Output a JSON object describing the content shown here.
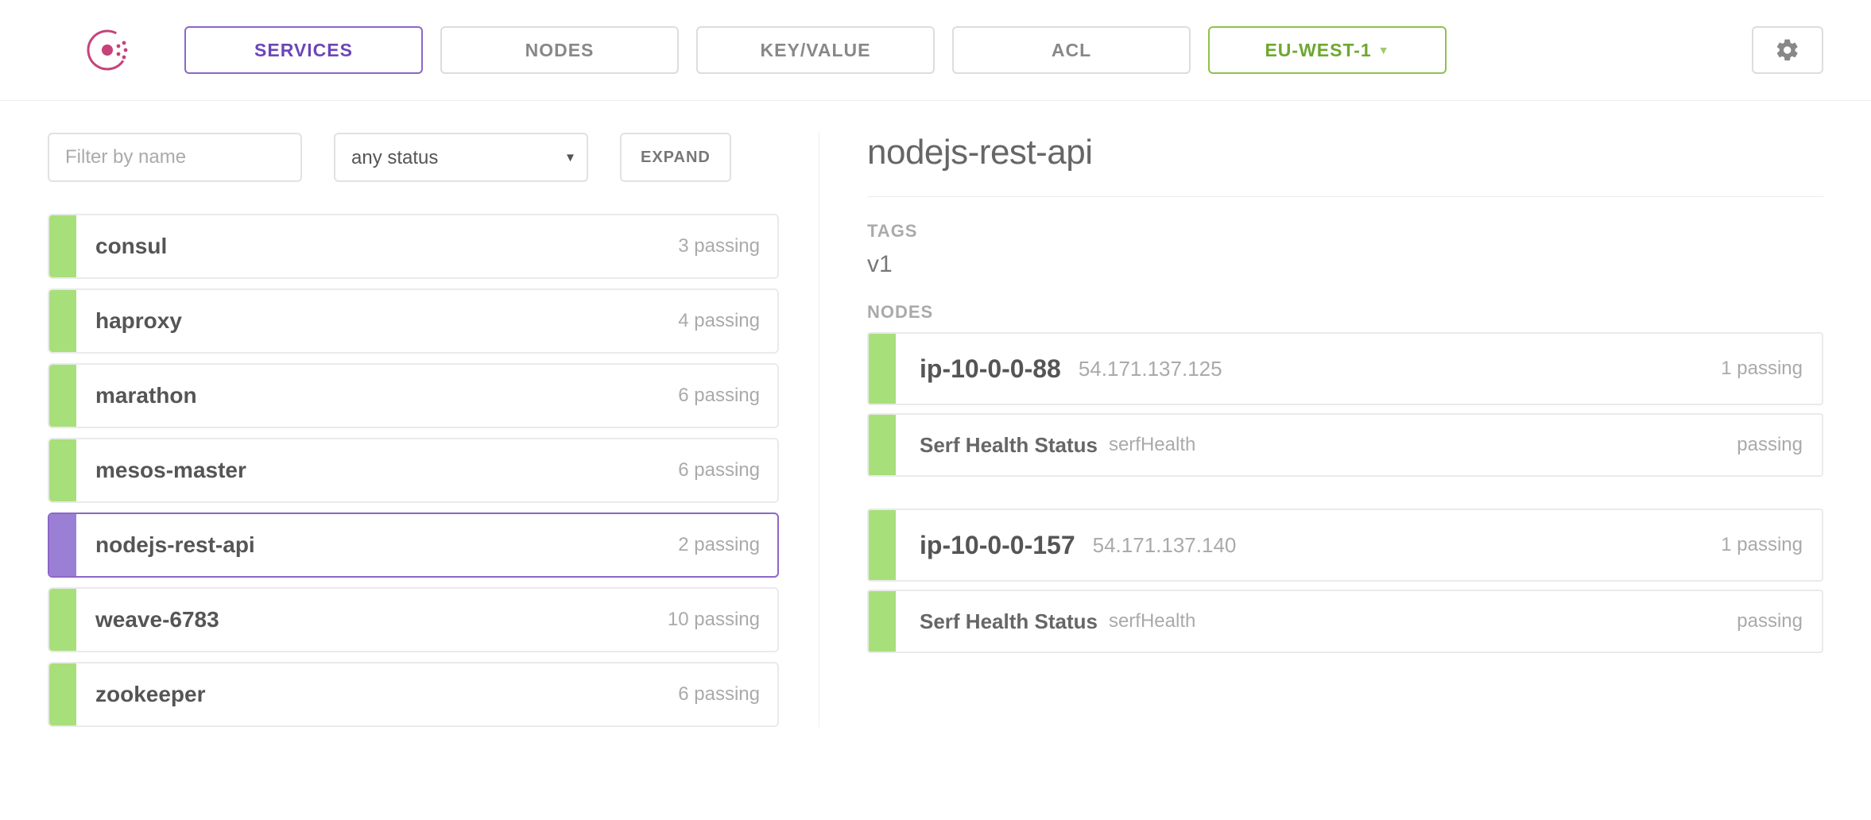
{
  "nav": {
    "services": "SERVICES",
    "nodes": "NODES",
    "keyvalue": "KEY/VALUE",
    "acl": "ACL",
    "region": "EU-WEST-1"
  },
  "filter": {
    "placeholder": "Filter by name",
    "value": ""
  },
  "status_select": {
    "selected": "any status"
  },
  "expand_label": "EXPAND",
  "services": [
    {
      "name": "consul",
      "status": "3 passing",
      "selected": false
    },
    {
      "name": "haproxy",
      "status": "4 passing",
      "selected": false
    },
    {
      "name": "marathon",
      "status": "6 passing",
      "selected": false
    },
    {
      "name": "mesos-master",
      "status": "6 passing",
      "selected": false
    },
    {
      "name": "nodejs-rest-api",
      "status": "2 passing",
      "selected": true
    },
    {
      "name": "weave-6783",
      "status": "10 passing",
      "selected": false
    },
    {
      "name": "zookeeper",
      "status": "6 passing",
      "selected": false
    }
  ],
  "detail": {
    "title": "nodejs-rest-api",
    "tags_label": "TAGS",
    "tags": "v1",
    "nodes_label": "NODES",
    "nodes": [
      {
        "name": "ip-10-0-0-88",
        "ip": "54.171.137.125",
        "status": "1 passing",
        "checks": [
          {
            "name": "Serf Health Status",
            "id": "serfHealth",
            "status": "passing"
          }
        ]
      },
      {
        "name": "ip-10-0-0-157",
        "ip": "54.171.137.140",
        "status": "1 passing",
        "checks": [
          {
            "name": "Serf Health Status",
            "id": "serfHealth",
            "status": "passing"
          }
        ]
      }
    ]
  }
}
